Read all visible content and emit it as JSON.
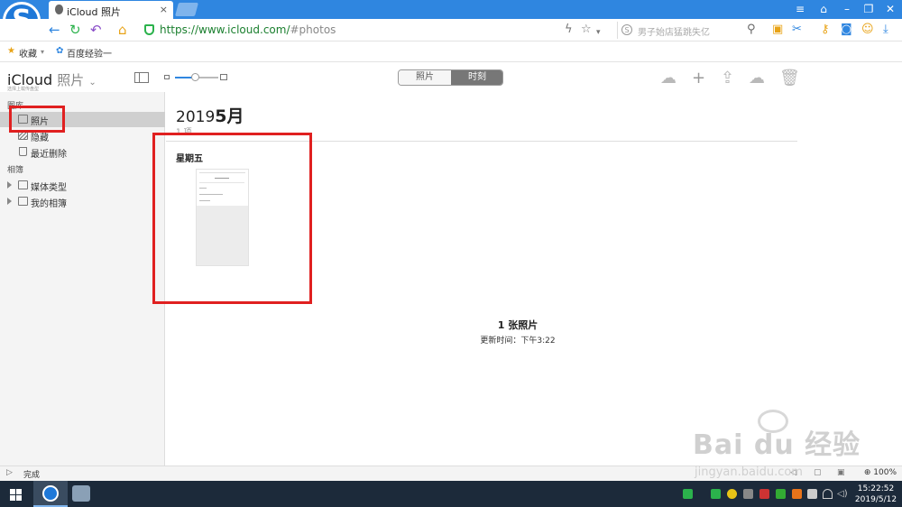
{
  "browser": {
    "tab_title": "iCloud 照片",
    "tab_close": "×",
    "url_host": "https://www.icloud.com/",
    "url_path": "#photos",
    "search_placeholder": "男子始店猛跳失亿",
    "bookmarks": [
      "收藏",
      "百度经验一"
    ],
    "window_buttons": [
      "≡",
      "⌂",
      "–",
      "❐",
      "✕"
    ]
  },
  "app": {
    "brand_name": "iCloud",
    "brand_section": "照片",
    "brand_subtitle": "选择上载传盘型",
    "segment": {
      "photos": "照片",
      "moments": "时刻"
    },
    "sidebar": {
      "library_header": "图库",
      "items": [
        {
          "label": "照片",
          "selected": true,
          "icon": "photos-icon"
        },
        {
          "label": "隐藏",
          "selected": false,
          "icon": "hidden-icon"
        },
        {
          "label": "最近删除",
          "selected": false,
          "icon": "trash-icon"
        }
      ],
      "albums_header": "相簿",
      "album_groups": [
        {
          "label": "媒体类型"
        },
        {
          "label": "我的相簿"
        }
      ]
    },
    "main": {
      "year": "2019",
      "month": "5月",
      "count": "1 项",
      "day_label": "星期五",
      "summary_title": "1 张照片",
      "summary_updated": "更新时间：下午3:22"
    }
  },
  "statusbar": {
    "status": "完成",
    "zoom": "100%"
  },
  "taskbar": {
    "time": "15:22:52",
    "date": "2019/5/12"
  },
  "watermark": {
    "brand": "Bai du 经验",
    "domain": "jingyan.baidu.com"
  },
  "colors": {
    "browser_blue": "#2f86e0",
    "highlight_red": "#e02020",
    "url_green": "#1a7f2e",
    "taskbar": "#1c2a3a"
  }
}
